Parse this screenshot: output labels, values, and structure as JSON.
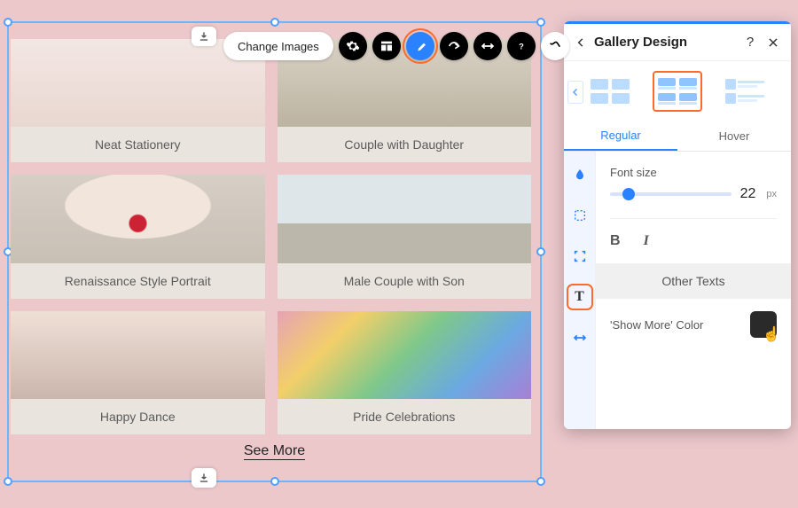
{
  "toolbar": {
    "change_images_label": "Change Images"
  },
  "gallery": {
    "see_more_label": "See More",
    "items": [
      {
        "caption": "Neat Stationery"
      },
      {
        "caption": "Couple with Daughter"
      },
      {
        "caption": "Renaissance Style Portrait"
      },
      {
        "caption": "Male Couple with Son"
      },
      {
        "caption": "Happy Dance"
      },
      {
        "caption": "Pride Celebrations"
      }
    ]
  },
  "panel": {
    "title": "Gallery Design",
    "tabs": {
      "regular": "Regular",
      "hover": "Hover"
    },
    "font_size_label": "Font size",
    "font_size_value": "22",
    "font_size_unit": "px",
    "other_texts_label": "Other Texts",
    "show_more_color_label": "'Show More' Color",
    "show_more_color_value": "#2a2a2a"
  },
  "icons": {
    "toolbar": [
      "gear-icon",
      "layout-icon",
      "brush-icon",
      "animation-icon",
      "stretch-icon",
      "help-icon",
      "more-icon"
    ],
    "side_rail": [
      "droplet-icon",
      "dashed-box-icon",
      "bounding-box-icon",
      "text-icon",
      "resize-h-icon"
    ]
  }
}
